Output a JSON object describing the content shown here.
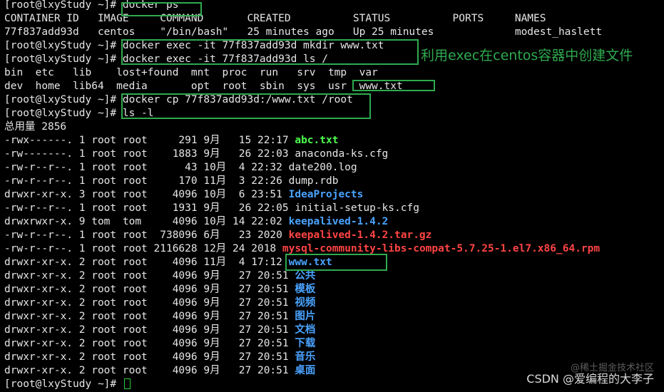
{
  "colors": {
    "background": "#000000",
    "text": "#e6e6e6",
    "directory": "#4aa3ff",
    "executable": "#4dff4d",
    "archive": "#ff4444",
    "highlight_box": "#2faa4f",
    "annotation": "#2faa4f"
  },
  "terminal": {
    "lines": [
      [
        {
          "text": "[root@lxyStudy ~]# docker ps",
          "color": "text"
        }
      ],
      [
        {
          "text": "CONTAINER ID   IMAGE     COMMAND       CREATED          STATUS          PORTS     NAMES",
          "color": "text"
        }
      ],
      [
        {
          "text": "77f837add93d   centos    \"/bin/bash\"   25 minutes ago   Up 25 minutes             modest_haslett",
          "color": "text"
        }
      ],
      [
        {
          "text": "[root@lxyStudy ~]# docker exec -it 77f837add93d mkdir www.txt",
          "color": "text"
        }
      ],
      [
        {
          "text": "[root@lxyStudy ~]# docker exec -it 77f837add93d ls /",
          "color": "text"
        }
      ],
      [
        {
          "text": "bin  etc   lib    lost+found  mnt  proc  run   srv  tmp  var",
          "color": "text"
        }
      ],
      [
        {
          "text": "dev  home  lib64  media       opt  root  sbin  sys  usr  www.txt",
          "color": "text"
        }
      ],
      [
        {
          "text": "[root@lxyStudy ~]# docker cp 77f837add93d:/www.txt /root",
          "color": "text"
        }
      ],
      [
        {
          "text": "[root@lxyStudy ~]# ls -l",
          "color": "text"
        }
      ],
      [
        {
          "text": "总用量 2856",
          "color": "text"
        }
      ],
      [
        {
          "text": "-rwx------. 1 root root     291 9月   15 22:17 ",
          "color": "text"
        },
        {
          "text": "abc.txt",
          "color": "executable"
        }
      ],
      [
        {
          "text": "-rw-------. 1 root root    1883 9月   26 22:03 anaconda-ks.cfg",
          "color": "text"
        }
      ],
      [
        {
          "text": "-rw-r--r--. 1 root root      43 10月  4 22:32 date200.log",
          "color": "text"
        }
      ],
      [
        {
          "text": "-rw-r--r--. 1 root root     170 11月  3 22:26 dump.rdb",
          "color": "text"
        }
      ],
      [
        {
          "text": "drwxr-xr-x. 3 root root    4096 10月  6 23:51 ",
          "color": "text"
        },
        {
          "text": "IdeaProjects",
          "color": "directory"
        }
      ],
      [
        {
          "text": "-rw-r--r--. 1 root root    1931 9月   26 22:05 initial-setup-ks.cfg",
          "color": "text"
        }
      ],
      [
        {
          "text": "drwxrwxr-x. 9 tom  tom     4096 10月 14 22:02 ",
          "color": "text"
        },
        {
          "text": "keepalived-1.4.2",
          "color": "directory"
        }
      ],
      [
        {
          "text": "-rw-r--r--. 1 root root  738096 6月   23 2020 ",
          "color": "text"
        },
        {
          "text": "keepalived-1.4.2.tar.gz",
          "color": "archive"
        }
      ],
      [
        {
          "text": "-rw-r--r--. 1 root root 2116628 12月 24 2018 ",
          "color": "text"
        },
        {
          "text": "mysql-community-libs-compat-5.7.25-1.el7.x86_64.rpm",
          "color": "archive"
        }
      ],
      [
        {
          "text": "drwxr-xr-x. 2 root root    4096 11月  4 17:12 ",
          "color": "text"
        },
        {
          "text": "www.txt",
          "color": "directory"
        }
      ],
      [
        {
          "text": "drwxr-xr-x. 2 root root    4096 9月   27 20:51 ",
          "color": "text"
        },
        {
          "text": "公共",
          "color": "directory"
        }
      ],
      [
        {
          "text": "drwxr-xr-x. 2 root root    4096 9月   27 20:51 ",
          "color": "text"
        },
        {
          "text": "模板",
          "color": "directory"
        }
      ],
      [
        {
          "text": "drwxr-xr-x. 2 root root    4096 9月   27 20:51 ",
          "color": "text"
        },
        {
          "text": "视频",
          "color": "directory"
        }
      ],
      [
        {
          "text": "drwxr-xr-x. 2 root root    4096 9月   27 20:51 ",
          "color": "text"
        },
        {
          "text": "图片",
          "color": "directory"
        }
      ],
      [
        {
          "text": "drwxr-xr-x. 2 root root    4096 9月   27 20:51 ",
          "color": "text"
        },
        {
          "text": "文档",
          "color": "directory"
        }
      ],
      [
        {
          "text": "drwxr-xr-x. 2 root root    4096 9月   27 20:51 ",
          "color": "text"
        },
        {
          "text": "下载",
          "color": "directory"
        }
      ],
      [
        {
          "text": "drwxr-xr-x. 2 root root    4096 9月   27 20:51 ",
          "color": "text"
        },
        {
          "text": "音乐",
          "color": "directory"
        }
      ],
      [
        {
          "text": "drwxr-xr-x. 2 root root    4096 9月   27 20:51 ",
          "color": "text"
        },
        {
          "text": "桌面",
          "color": "directory"
        }
      ],
      [
        {
          "text": "[root@lxyStudy ~]# ",
          "color": "text"
        }
      ]
    ]
  },
  "annotation": {
    "text": "利用exec在centos容器中创建文件"
  },
  "watermark": {
    "text": "CSDN @爱编程的大李子",
    "secondary": "@稀土掘金技术社区"
  }
}
